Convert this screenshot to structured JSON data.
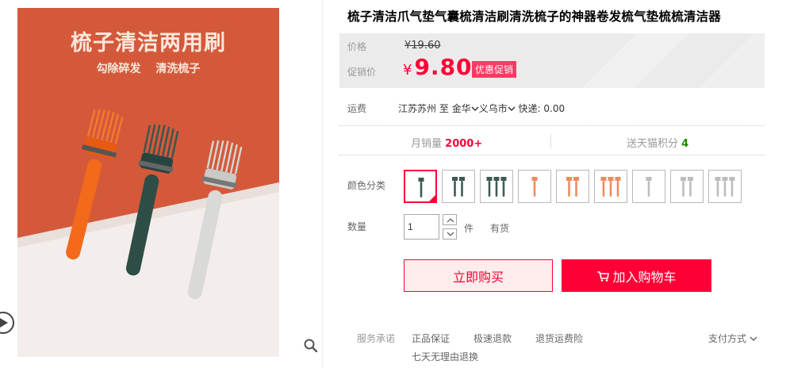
{
  "gallery": {
    "ad_title": "梳子清洁两用刷",
    "ad_subtitle": "勾除碎发 清洗梳子"
  },
  "product": {
    "title": "梳子清洁爪气垫气囊梳清洁刷清洗梳子的神器卷发梳气垫梳梳清洁器"
  },
  "price": {
    "orig_label": "价格",
    "orig_value": "¥19.60",
    "promo_label": "促销价",
    "promo_currency": "¥",
    "promo_value": "9.80",
    "promo_badge": "优惠促销"
  },
  "shipping": {
    "label": "运费",
    "from": "江苏苏州",
    "to_prefix": "至",
    "to_province": "金华",
    "to_city": "义乌市",
    "method": "快递: 0.00"
  },
  "stats": {
    "monthly_label": "月销量",
    "monthly_value": "2000+",
    "points_label": "送天猫积分",
    "points_value": "4"
  },
  "options": {
    "color_label": "颜色分类",
    "swatches": [
      {
        "color": "#3f5a55",
        "count": 1
      },
      {
        "color": "#3f5a55",
        "count": 2
      },
      {
        "color": "#3f5a55",
        "count": 3
      },
      {
        "color": "#f08a5d",
        "count": 1
      },
      {
        "color": "#f08a5d",
        "count": 2
      },
      {
        "color": "#f08a5d",
        "count": 3
      },
      {
        "color": "#bdbdbd",
        "count": 1
      },
      {
        "color": "#bdbdbd",
        "count": 2
      },
      {
        "color": "#bdbdbd",
        "count": 3
      }
    ],
    "selected_index": 0
  },
  "quantity": {
    "label": "数量",
    "value": "1",
    "unit": "件",
    "stock": "有货"
  },
  "actions": {
    "buy_now": "立即购买",
    "add_cart": "加入购物车"
  },
  "service": {
    "label": "服务承诺",
    "items": [
      "正品保证",
      "极速退款",
      "退货运费险",
      "七天无理由退换"
    ],
    "payment": "支付方式"
  },
  "colors": {
    "accent": "#ff0036",
    "ad_background": "#d4593b"
  }
}
